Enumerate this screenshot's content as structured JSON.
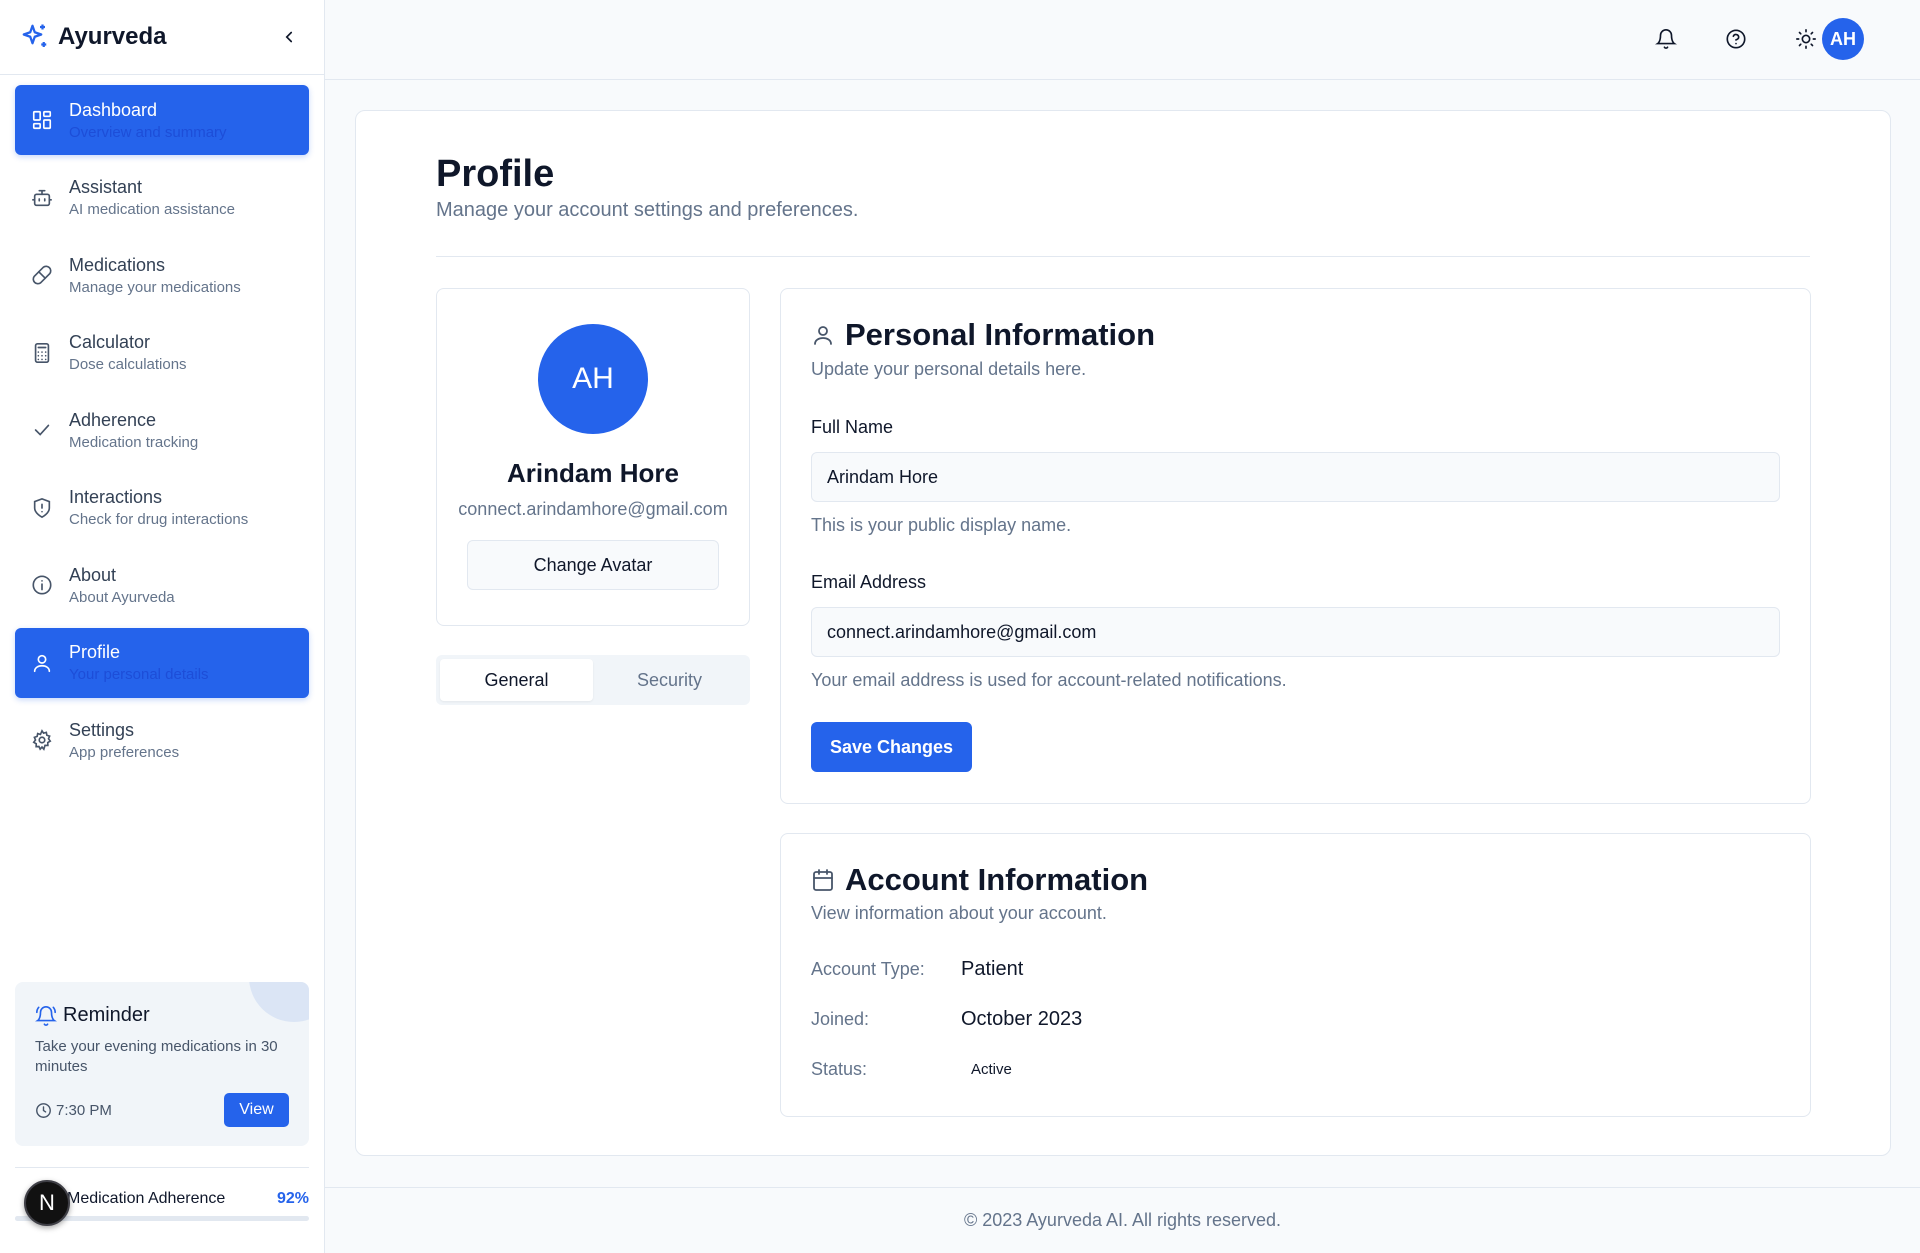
{
  "brand": {
    "name": "Ayurveda"
  },
  "sidebar": {
    "items": [
      {
        "label": "Dashboard",
        "sub": "Overview and summary",
        "icon": "dashboard-icon",
        "active": true
      },
      {
        "label": "Assistant",
        "sub": "AI medication assistance",
        "icon": "bot-icon",
        "active": false
      },
      {
        "label": "Medications",
        "sub": "Manage your medications",
        "icon": "pill-icon",
        "active": false
      },
      {
        "label": "Calculator",
        "sub": "Dose calculations",
        "icon": "calculator-icon",
        "active": false
      },
      {
        "label": "Adherence",
        "sub": "Medication tracking",
        "icon": "check-icon",
        "active": false
      },
      {
        "label": "Interactions",
        "sub": "Check for drug interactions",
        "icon": "shield-alert-icon",
        "active": false
      },
      {
        "label": "About",
        "sub": "About Ayurveda",
        "icon": "info-icon",
        "active": false
      },
      {
        "label": "Profile",
        "sub": "Your personal details",
        "icon": "user-icon",
        "active": true
      },
      {
        "label": "Settings",
        "sub": "App preferences",
        "icon": "gear-icon",
        "active": false
      }
    ]
  },
  "reminder": {
    "title": "Reminder",
    "message": "Take your evening medications in 30 minutes",
    "time": "7:30 PM",
    "view_label": "View"
  },
  "adherence": {
    "label": "Medication Adherence",
    "value": "92%",
    "fraction": 0.92
  },
  "badge_letter": "N",
  "topbar": {
    "avatar_initials": "AH"
  },
  "page": {
    "title": "Profile",
    "subtitle": "Manage your account settings and preferences."
  },
  "profile": {
    "initials": "AH",
    "name": "Arindam Hore",
    "email": "connect.arindamhore@gmail.com",
    "change_avatar_label": "Change Avatar"
  },
  "tabs": [
    {
      "label": "General",
      "active": true
    },
    {
      "label": "Security",
      "active": false
    }
  ],
  "personal": {
    "title": "Personal Information",
    "subtitle": "Update your personal details here.",
    "full_name_label": "Full Name",
    "full_name_value": "Arindam Hore",
    "full_name_help": "This is your public display name.",
    "email_label": "Email Address",
    "email_value": "connect.arindamhore@gmail.com",
    "email_help": "Your email address is used for account-related notifications.",
    "save_label": "Save Changes"
  },
  "account": {
    "title": "Account Information",
    "subtitle": "View information about your account.",
    "rows": [
      {
        "key": "Account Type:",
        "value": "Patient"
      },
      {
        "key": "Joined:",
        "value": "October 2023"
      },
      {
        "key": "Status:",
        "value": "Active"
      }
    ]
  },
  "footer": {
    "text": "© 2023 Ayurveda AI. All rights reserved."
  },
  "colors": {
    "accent": "#2563eb",
    "text": "#0f172a",
    "muted": "#64748b",
    "border": "#e2e8f0"
  }
}
